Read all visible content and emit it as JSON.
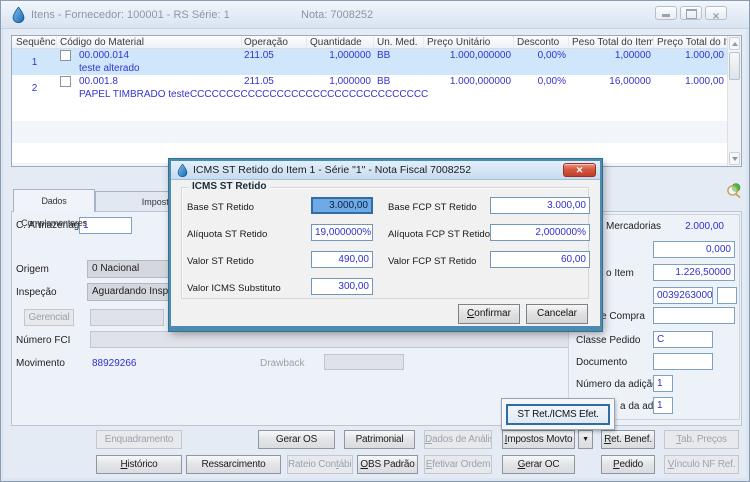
{
  "window": {
    "title_left": "Itens - Fornecedor: 100001 - RS Série: 1",
    "title_right": "Nota: 7008252"
  },
  "items_table": {
    "columns": [
      "Sequência",
      "Código do Material",
      "Operação",
      "Quantidade",
      "Un. Med.",
      "Preço Unitário",
      "Desconto",
      "Peso Total do Item",
      "Preço Total do Item"
    ],
    "rows": [
      {
        "seq": "1",
        "code": "00.000.014",
        "description": "teste alterado",
        "operation": "211.05",
        "quantity": "1,000000",
        "unit": "BB",
        "unit_price": "1.000,000000",
        "discount": "0,00%",
        "weight_total": "1,00000",
        "price_total": "1.000,00",
        "selected": true
      },
      {
        "seq": "2",
        "code": "00.001.8",
        "description": "PAPEL TIMBRADO testeCCCCCCCCCCCCCCCCCCCCCCCCCCCCCCCCC",
        "operation": "211.05",
        "quantity": "1,000000",
        "unit": "BB",
        "unit_price": "1.000,000000",
        "discount": "0,00%",
        "weight_total": "16,00000",
        "price_total": "1.000,00",
        "selected": false
      }
    ]
  },
  "tabs": {
    "complementares": "Dados Complementares",
    "impostos": "Impostos"
  },
  "form": {
    "armazenagem_label": "C. Armazenagem",
    "armazenagem_value": "1",
    "origem_label": "Origem",
    "origem_value": "0 Nacional",
    "inspecao_label": "Inspeção",
    "inspecao_value": "Aguardando Inspeção",
    "gerencial_button": "Gerencial",
    "numero_fci_label": "Número FCI",
    "movimento_label": "Movimento",
    "movimento_value": "88929266",
    "drawback_label": "Drawback"
  },
  "totals": {
    "mercadorias_label": "Mercadorias",
    "mercadorias_value": "2.000,00",
    "peso_value": "0,000",
    "item_label": "o Item",
    "item_value": "1.226,50000",
    "codigo_value": "0039263000",
    "compra_label": "e Compra",
    "classe_pedido_label": "Classe Pedido",
    "classe_pedido_value": "C",
    "documento_label": "Documento",
    "numero_adicao_label": "Número da adição",
    "numero_adicao_value": "1",
    "sequencia_adicao_label": "a da adição",
    "sequencia_adicao_value": "1"
  },
  "popup": {
    "st_ret_icms_button": "ST Ret./ICMS Efet."
  },
  "dialog": {
    "title": "ICMS ST Retido do Item 1 - Série \"1\" - Nota Fiscal 7008252",
    "group_title": "ICMS ST Retido",
    "base_st": {
      "label": "Base ST Retido",
      "value": "3.000,00"
    },
    "base_fcp": {
      "label": "Base FCP ST Retido",
      "value": "3.000,00"
    },
    "aliquota_st": {
      "label": "Alíquota ST Retido",
      "value": "19,000000%"
    },
    "aliquota_fcp": {
      "label": "Alíquota FCP ST Retido",
      "value": "2,000000%"
    },
    "valor_st": {
      "label": "Valor ST Retido",
      "value": "490,00"
    },
    "valor_fcp": {
      "label": "Valor FCP ST Retido",
      "value": "60,00"
    },
    "valor_icms_substituto": {
      "label": "Valor ICMS Substituto",
      "value": "300,00"
    },
    "confirm_button": "Confirmar",
    "cancel_button": "Cancelar"
  },
  "actions": {
    "enquadramento": "Enquadramento",
    "gerar_os": "Gerar OS",
    "patrimonial": "Patrimonial",
    "dados_analise": "Dados de Análise",
    "impostos_movto": "Impostos Movto",
    "ret_benef": "Ret. Benef.",
    "tab_precos": "Tab. Preços",
    "historico": "Histórico",
    "ressarcimento": "Ressarcimento",
    "rateio_contabil": "Rateio Contábil",
    "obs_padrao": "OBS Padrão",
    "efetivar_ordem": "Efetivar Ordem",
    "gerar_oc": "Gerar OC",
    "pedido": "Pedido",
    "vinculo_nf_ref": "Vínculo NF Ref."
  }
}
